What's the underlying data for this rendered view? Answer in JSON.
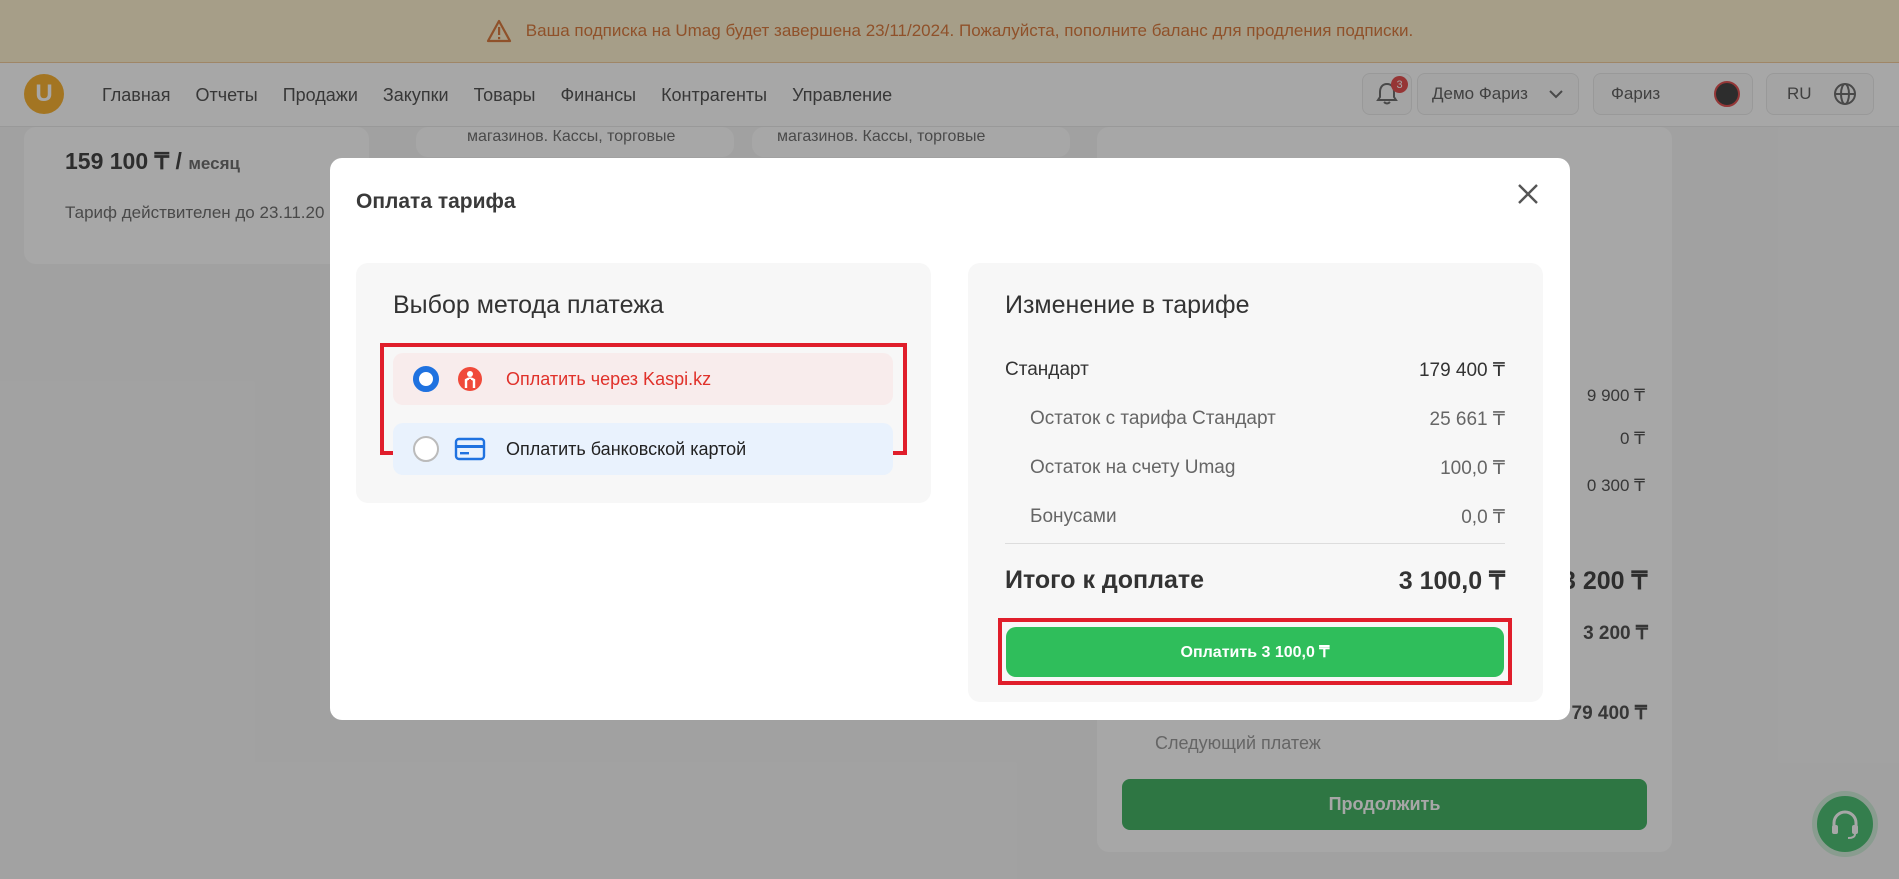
{
  "banner": {
    "text": "Ваша подписка на Umag будет завершена 23/11/2024. Пожалуйста, пополните баланс для продления подписки."
  },
  "nav": {
    "logo": "U",
    "items": [
      "Главная",
      "Отчеты",
      "Продажи",
      "Закупки",
      "Товары",
      "Финансы",
      "Контрагенты",
      "Управление"
    ],
    "notifications_count": "3",
    "store": "Демо Фариз",
    "user": "Фариз",
    "language": "RU"
  },
  "background": {
    "price": "159 100 ₸ /",
    "price_unit": "месяц",
    "valid_until": "Тариф действителен до 23.11.20",
    "card_desc_1": "магазинов. Кассы, торговые",
    "card_desc_2": "магазинов. Кассы, торговые",
    "amounts": [
      "9 900 ₸",
      "0 ₸",
      "0 300 ₸"
    ],
    "big_total": "3 200 ₸",
    "sub_total": "3 200 ₸",
    "next_amount": "79 400 ₸",
    "next_payment": "Следующий платеж",
    "continue_label": "Продолжить"
  },
  "modal": {
    "title": "Оплата тарифа",
    "payment": {
      "heading": "Выбор метода платежа",
      "options": [
        {
          "label": "Оплатить через Kaspi.kz",
          "selected": true,
          "icon": "kaspi-icon"
        },
        {
          "label": "Оплатить банковской картой",
          "selected": false,
          "icon": "credit-card-icon"
        }
      ]
    },
    "summary": {
      "heading": "Изменение в тарифе",
      "plan": {
        "label": "Стандарт",
        "value": "179 400 ₸"
      },
      "deductions": [
        {
          "label": "Остаток с тарифа Стандарт",
          "value": "25 661 ₸"
        },
        {
          "label": "Остаток на счету Umag",
          "value": "100,0 ₸"
        },
        {
          "label": "Бонусами",
          "value": "0,0 ₸"
        }
      ],
      "total": {
        "label": "Итого к доплате",
        "value": "3 100,0 ₸"
      },
      "pay_button": "Оплатить 3 100,0 ₸"
    }
  },
  "colors": {
    "accent_green": "#2fbe5b",
    "highlight_red": "#e01e2b",
    "kaspi_red": "#e0312a",
    "radio_blue": "#1f72e0",
    "banner_text": "#d4631c"
  }
}
